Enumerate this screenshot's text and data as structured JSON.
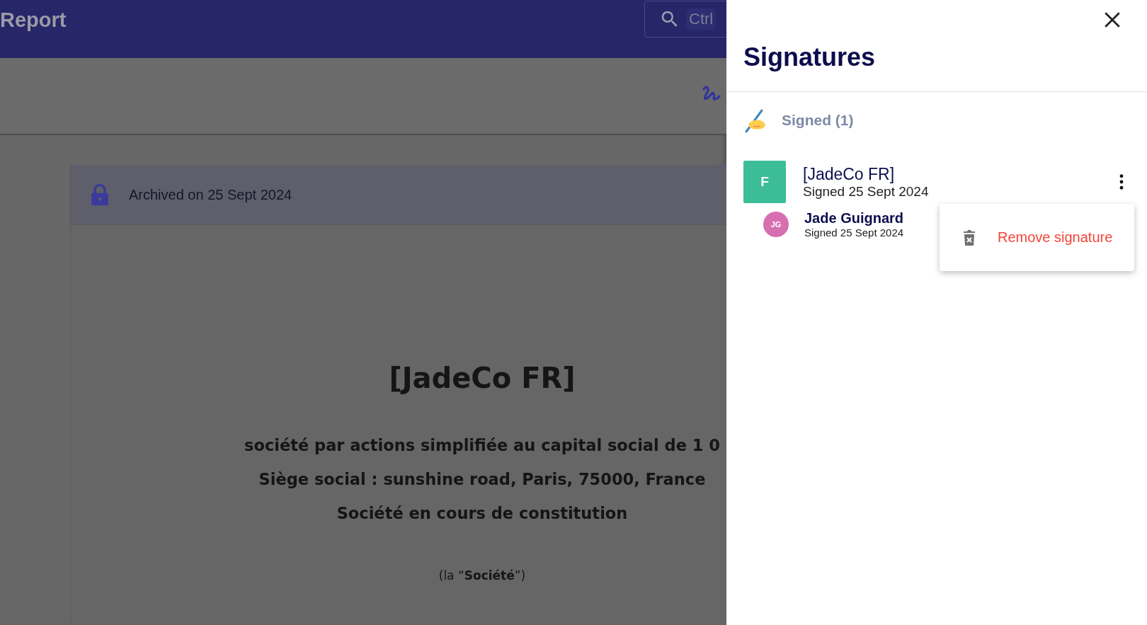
{
  "header": {
    "title": "Report",
    "search": {
      "shortcut": "Ctrl"
    }
  },
  "document": {
    "archived_notice": "Archived on 25 Sept 2024",
    "company": "[JadeCo FR]",
    "lines": [
      "société par actions simplifiée au capital social de 1 0",
      "Siège social : sunshine road, Paris, 75000, France",
      "Société en cours de constitution"
    ],
    "designation": "(la “**Société**”)"
  },
  "panel": {
    "title": "Signatures",
    "section": {
      "label": "Signed (1)"
    },
    "signers": [
      {
        "initial": "F",
        "name": "[JadeCo FR]",
        "date": "Signed 25 Sept 2024",
        "menu_open": true,
        "members": [
          {
            "initials": "JG",
            "name": "Jade Guignard",
            "date": "Signed 25 Sept 2024"
          }
        ]
      }
    ],
    "menu": {
      "items": [
        {
          "label": "Remove signature"
        }
      ]
    }
  }
}
